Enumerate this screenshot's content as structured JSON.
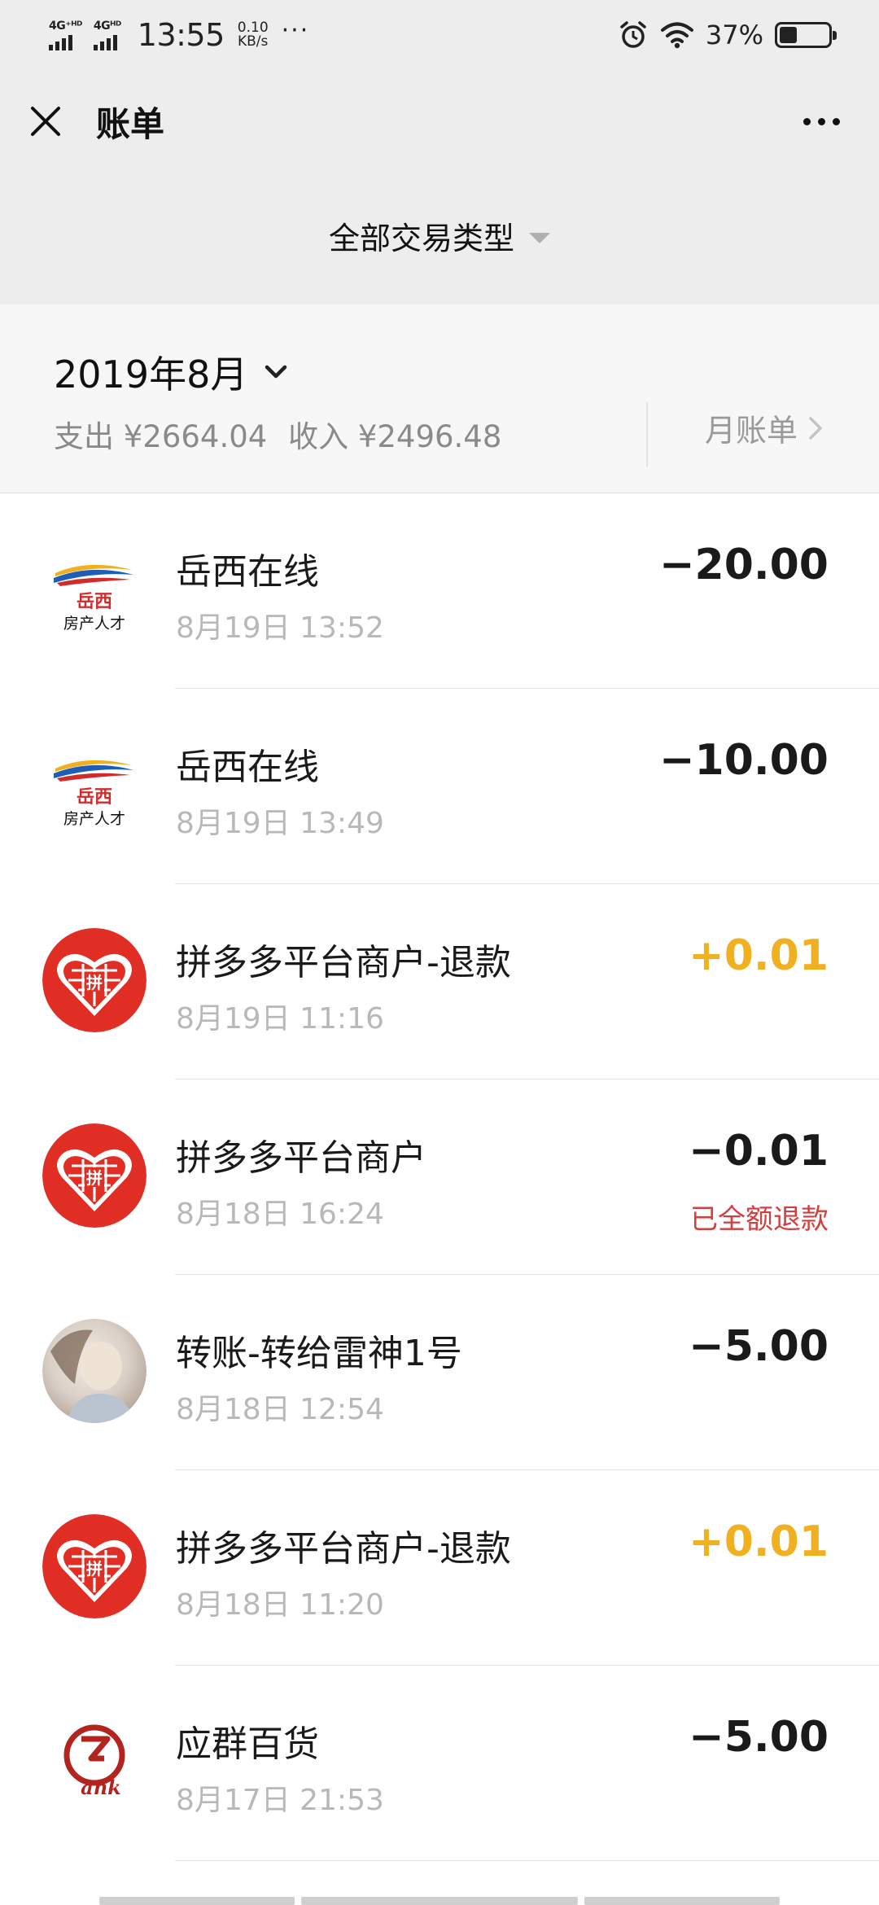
{
  "status_bar": {
    "sim1": "4G⁺ᴴᴰ",
    "sim2": "4Gᴴᴰ",
    "time": "13:55",
    "speed_value": "0.10",
    "speed_unit": "KB/s",
    "battery_percent": "37%",
    "battery_level": 0.37
  },
  "nav": {
    "title": "账单"
  },
  "filter": {
    "label": "全部交易类型"
  },
  "summary": {
    "month": "2019年8月",
    "expense": "支出 ¥2664.04",
    "income": "收入 ¥2496.48",
    "monthly_bill": "月账单"
  },
  "transactions": [
    {
      "name": "岳西在线",
      "time": "8月19日 13:52",
      "amount": "−20.00",
      "icon": "yuexi-logo"
    },
    {
      "name": "岳西在线",
      "time": "8月19日 13:49",
      "amount": "−10.00",
      "icon": "yuexi-logo"
    },
    {
      "name": "拼多多平台商户-退款",
      "time": "8月19日 11:16",
      "amount": "+0.01",
      "icon": "pinduoduo-logo",
      "type": "income"
    },
    {
      "name": "拼多多平台商户",
      "time": "8月18日 16:24",
      "amount": "−0.01",
      "note": "已全额退款",
      "icon": "pinduoduo-logo"
    },
    {
      "name": "转账-转给雷神1号",
      "time": "8月18日 12:54",
      "amount": "−5.00",
      "icon": "user-avatar"
    },
    {
      "name": "拼多多平台商户-退款",
      "time": "8月18日 11:20",
      "amount": "+0.01",
      "icon": "pinduoduo-logo",
      "type": "income"
    },
    {
      "name": "应群百货",
      "time": "8月17日 21:53",
      "amount": "−5.00",
      "icon": "rank-logo"
    }
  ],
  "logos": {
    "yuexi_text1": "岳西",
    "yuexi_text2": "房产人才",
    "pinduoduo_char": "拼",
    "rank_text": "ank"
  },
  "colors": {
    "income": "#f0b020",
    "refund_note": "#d23f3f",
    "pinduoduo_red": "#e02e24"
  }
}
